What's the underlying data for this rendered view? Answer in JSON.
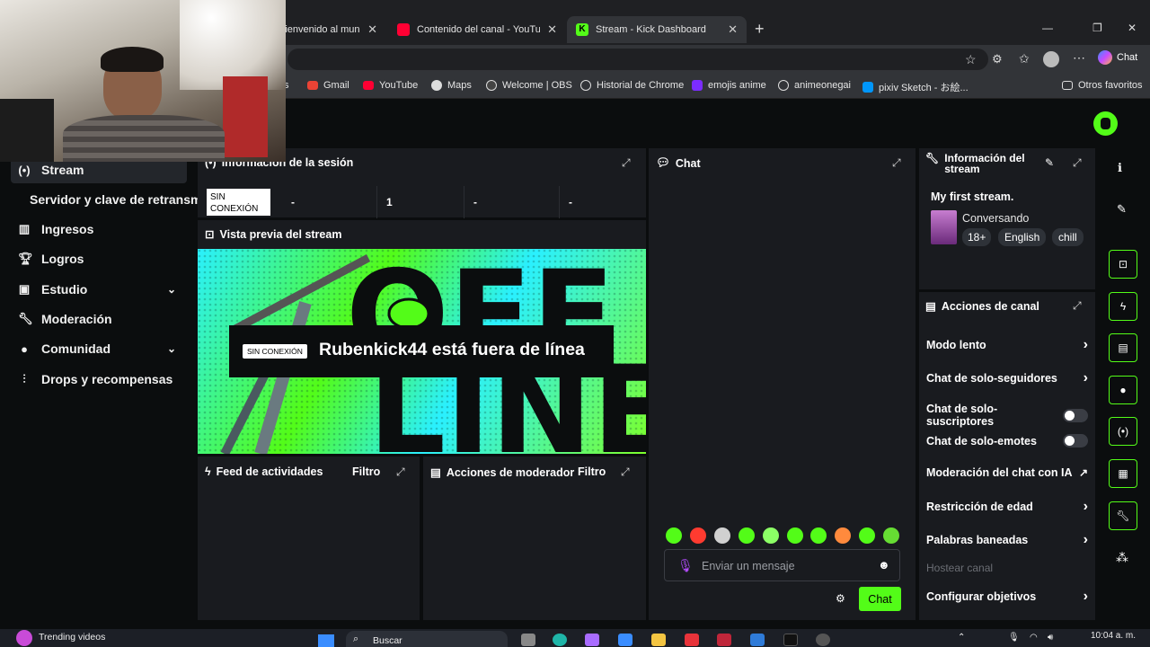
{
  "browser": {
    "tabs": [
      {
        "label": "Bienvenido al mundo del ...",
        "active": false
      },
      {
        "label": "Contenido del canal - YouTube Stu",
        "active": false
      },
      {
        "label": "Stream - Kick Dashboard",
        "active": true
      }
    ],
    "chat_button": "Chat",
    "bookmarks": [
      "s",
      "Gmail",
      "YouTube",
      "Maps",
      "Welcome | OBS",
      "Historial de Chrome",
      "emojis anime",
      "animeonegai",
      "pixiv Sketch - お絵...",
      "Otros favoritos"
    ]
  },
  "sidebar": {
    "items": [
      {
        "label": "Stream",
        "icon": "broadcast-icon"
      },
      {
        "label": "Servidor y clave de retransm",
        "icon": ""
      },
      {
        "label": "Ingresos",
        "icon": "chart-icon"
      },
      {
        "label": "Logros",
        "icon": "trophy-icon"
      },
      {
        "label": "Estudio",
        "icon": "studio-icon"
      },
      {
        "label": "Moderación",
        "icon": "wrench-icon"
      },
      {
        "label": "Comunidad",
        "icon": "community-icon"
      },
      {
        "label": "Drops y recompensas",
        "icon": "drops-icon"
      }
    ]
  },
  "session": {
    "title": "Información de la sesión",
    "status_badge": "SIN CONEXIÓN",
    "stats": [
      "-",
      "1",
      "-",
      "-"
    ]
  },
  "preview": {
    "title": "Vista previa del stream",
    "badge": "SIN CONEXIÓN",
    "message": "Rubenkick44 está fuera de línea"
  },
  "activity": {
    "title": "Feed de actividades",
    "filter": "Filtro"
  },
  "modactions": {
    "title": "Acciones de moderador",
    "filter": "Filtro"
  },
  "chat": {
    "title": "Chat",
    "placeholder": "Enviar un mensaje",
    "send_label": "Chat"
  },
  "stream_info": {
    "title_line1": "Información del",
    "title_line2": "stream",
    "stream_title": "My first stream.",
    "category": "Conversando",
    "tags": [
      "18+",
      "English",
      "chill"
    ]
  },
  "channel_actions": {
    "title": "Acciones de canal",
    "rows": [
      {
        "label": "Modo lento",
        "control": "arrow"
      },
      {
        "label": "Chat de solo-seguidores",
        "control": "arrow"
      },
      {
        "label": "Chat de solo-suscriptores",
        "control": "toggle"
      },
      {
        "label": "Chat de solo-emotes",
        "control": "toggle"
      },
      {
        "label": "Moderación del chat con IA",
        "control": "external"
      },
      {
        "label": "Restricción de edad",
        "control": "arrow"
      },
      {
        "label": "Palabras baneadas",
        "control": "arrow"
      },
      {
        "label": "Hostear canal",
        "control": "disabled"
      },
      {
        "label": "Configurar objetivos",
        "control": "arrow"
      }
    ]
  },
  "taskbar": {
    "widget_title": "Trending videos",
    "search": "Buscar",
    "time": "10:04 a. m."
  },
  "colors": {
    "accent": "#53fc18",
    "panel": "#191b1f",
    "background": "#0b0d0e"
  }
}
